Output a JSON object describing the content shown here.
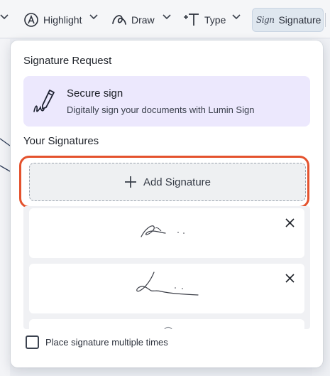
{
  "toolbar": {
    "highlight_label": "Highlight",
    "draw_label": "Draw",
    "type_label": "Type",
    "signature_label": "Signature",
    "signature_glyph": "Sign"
  },
  "panel": {
    "request_title": "Signature Request",
    "secure_sign": {
      "title": "Secure sign",
      "description": "Digitally sign your documents with Lumin Sign"
    },
    "your_signatures_title": "Your Signatures",
    "add_signature_label": "Add Signature",
    "signatures": [
      {
        "name": "saved-signature-1"
      },
      {
        "name": "saved-signature-2"
      },
      {
        "name": "saved-signature-3"
      }
    ],
    "place_multiple_label": "Place signature multiple times",
    "place_multiple_checked": false
  },
  "colors": {
    "accent_highlight": "#e4522d",
    "secure_card_bg": "#ece8fd",
    "active_tool_bg": "#dfe7ef"
  }
}
